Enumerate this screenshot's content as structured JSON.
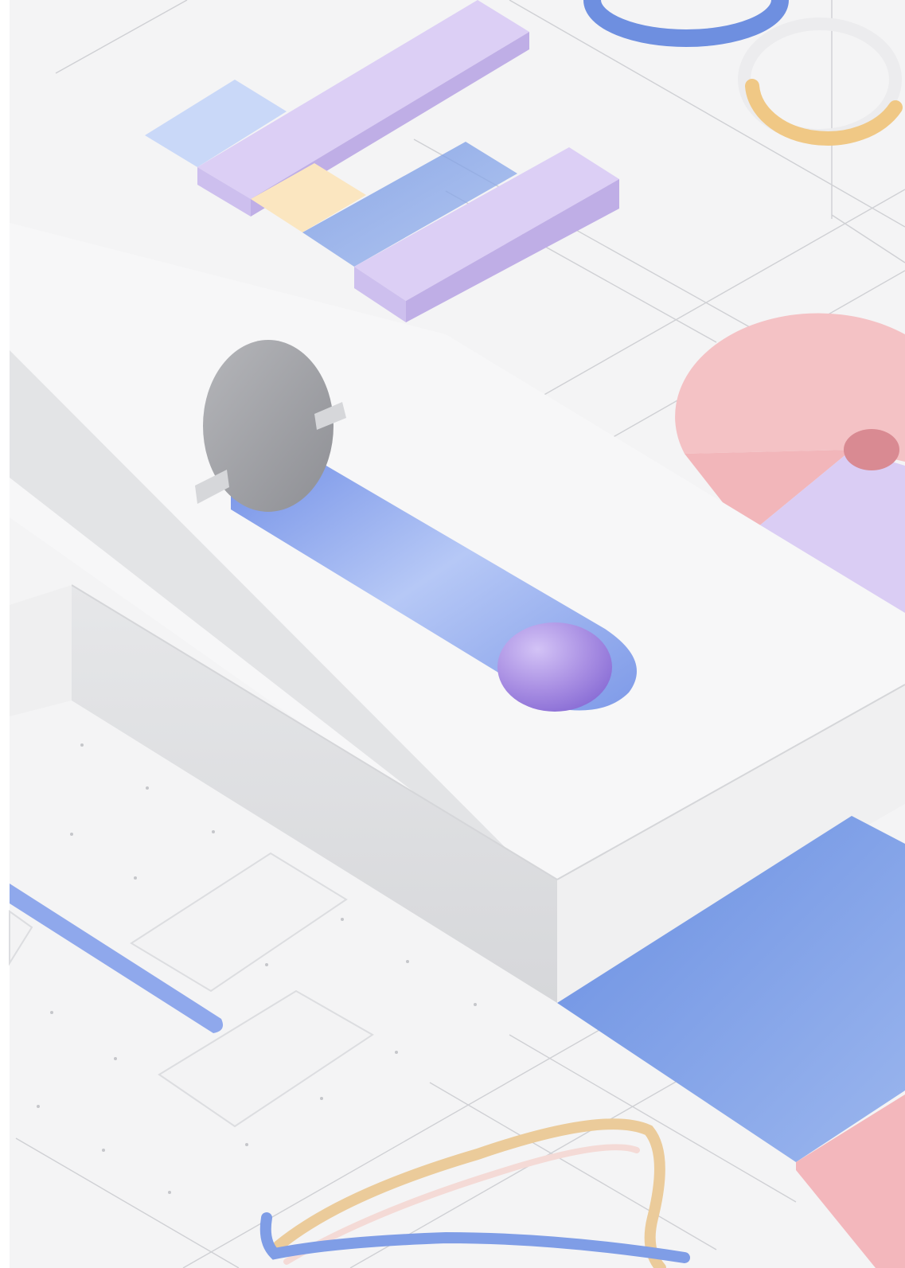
{
  "scene": {
    "description_kind": "isometric-3d-illustration",
    "has_visible_text": false,
    "colors": {
      "background": "#F3F3F4",
      "panel_top": "#F6F6F7",
      "panel_side": "#DEDFE1",
      "grid_line": "#CDCED2",
      "bar_purple": "#D4C6F2",
      "bar_blue": "#B9CCF6",
      "bar_peach": "#FBE3B8",
      "ring_blue": "#6E8FE0",
      "ring_peach": "#F0C885",
      "pie_pink": "#F4B8BC",
      "pie_lilac": "#D7C9F2",
      "groove_blue": "#8FA8EC",
      "ball_purple": "#A88FE2",
      "gate_grey": "#A7A8AC",
      "plate_blue": "#7C9EE6",
      "plate_pink": "#F1B3B8",
      "tube_peach": "#EBCB9A",
      "tube_blue": "#7F9DE6"
    }
  }
}
